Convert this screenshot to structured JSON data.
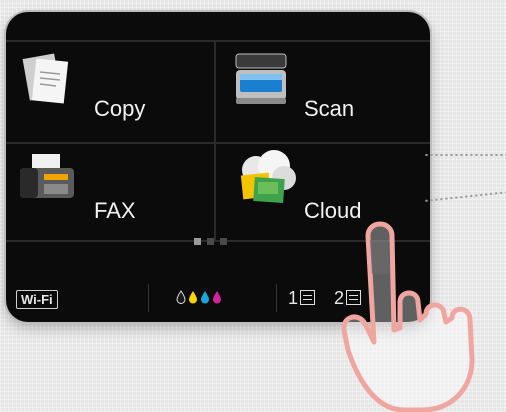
{
  "tiles": [
    {
      "id": "copy",
      "label": "Copy",
      "icon": "copy-icon"
    },
    {
      "id": "scan",
      "label": "Scan",
      "icon": "scan-icon"
    },
    {
      "id": "fax",
      "label": "FAX",
      "icon": "fax-icon"
    },
    {
      "id": "cloud",
      "label": "Cloud",
      "icon": "cloud-icon"
    }
  ],
  "pager": {
    "pages": 3,
    "current": 1
  },
  "status": {
    "wifi_label": "Wi-Fi",
    "ink_colors": [
      "#1a1a1a",
      "#f5d400",
      "#19a6d8",
      "#d1249a"
    ],
    "tray1": "1",
    "tray2": "2"
  },
  "colors": {
    "panel": "#0b0b0b",
    "text": "#f2f2f2",
    "hand": "#f0a6a0"
  }
}
